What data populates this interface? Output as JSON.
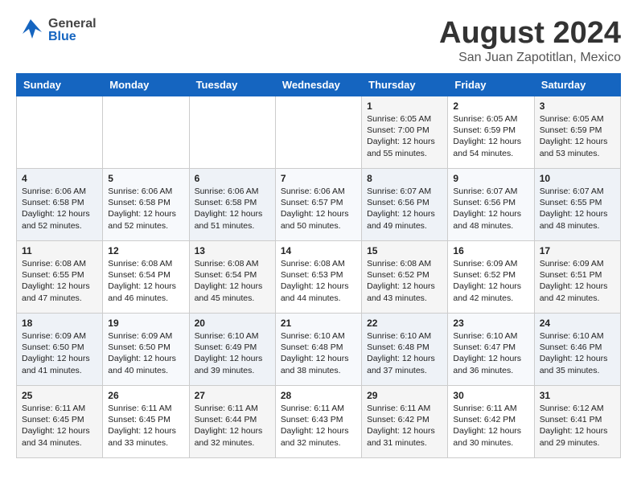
{
  "header": {
    "logo_general": "General",
    "logo_blue": "Blue",
    "month_year": "August 2024",
    "location": "San Juan Zapotitlan, Mexico"
  },
  "days_of_week": [
    "Sunday",
    "Monday",
    "Tuesday",
    "Wednesday",
    "Thursday",
    "Friday",
    "Saturday"
  ],
  "weeks": [
    [
      {
        "day": "",
        "info": ""
      },
      {
        "day": "",
        "info": ""
      },
      {
        "day": "",
        "info": ""
      },
      {
        "day": "",
        "info": ""
      },
      {
        "day": "1",
        "info": "Sunrise: 6:05 AM\nSunset: 7:00 PM\nDaylight: 12 hours\nand 55 minutes."
      },
      {
        "day": "2",
        "info": "Sunrise: 6:05 AM\nSunset: 6:59 PM\nDaylight: 12 hours\nand 54 minutes."
      },
      {
        "day": "3",
        "info": "Sunrise: 6:05 AM\nSunset: 6:59 PM\nDaylight: 12 hours\nand 53 minutes."
      }
    ],
    [
      {
        "day": "4",
        "info": "Sunrise: 6:06 AM\nSunset: 6:58 PM\nDaylight: 12 hours\nand 52 minutes."
      },
      {
        "day": "5",
        "info": "Sunrise: 6:06 AM\nSunset: 6:58 PM\nDaylight: 12 hours\nand 52 minutes."
      },
      {
        "day": "6",
        "info": "Sunrise: 6:06 AM\nSunset: 6:58 PM\nDaylight: 12 hours\nand 51 minutes."
      },
      {
        "day": "7",
        "info": "Sunrise: 6:06 AM\nSunset: 6:57 PM\nDaylight: 12 hours\nand 50 minutes."
      },
      {
        "day": "8",
        "info": "Sunrise: 6:07 AM\nSunset: 6:56 PM\nDaylight: 12 hours\nand 49 minutes."
      },
      {
        "day": "9",
        "info": "Sunrise: 6:07 AM\nSunset: 6:56 PM\nDaylight: 12 hours\nand 48 minutes."
      },
      {
        "day": "10",
        "info": "Sunrise: 6:07 AM\nSunset: 6:55 PM\nDaylight: 12 hours\nand 48 minutes."
      }
    ],
    [
      {
        "day": "11",
        "info": "Sunrise: 6:08 AM\nSunset: 6:55 PM\nDaylight: 12 hours\nand 47 minutes."
      },
      {
        "day": "12",
        "info": "Sunrise: 6:08 AM\nSunset: 6:54 PM\nDaylight: 12 hours\nand 46 minutes."
      },
      {
        "day": "13",
        "info": "Sunrise: 6:08 AM\nSunset: 6:54 PM\nDaylight: 12 hours\nand 45 minutes."
      },
      {
        "day": "14",
        "info": "Sunrise: 6:08 AM\nSunset: 6:53 PM\nDaylight: 12 hours\nand 44 minutes."
      },
      {
        "day": "15",
        "info": "Sunrise: 6:08 AM\nSunset: 6:52 PM\nDaylight: 12 hours\nand 43 minutes."
      },
      {
        "day": "16",
        "info": "Sunrise: 6:09 AM\nSunset: 6:52 PM\nDaylight: 12 hours\nand 42 minutes."
      },
      {
        "day": "17",
        "info": "Sunrise: 6:09 AM\nSunset: 6:51 PM\nDaylight: 12 hours\nand 42 minutes."
      }
    ],
    [
      {
        "day": "18",
        "info": "Sunrise: 6:09 AM\nSunset: 6:50 PM\nDaylight: 12 hours\nand 41 minutes."
      },
      {
        "day": "19",
        "info": "Sunrise: 6:09 AM\nSunset: 6:50 PM\nDaylight: 12 hours\nand 40 minutes."
      },
      {
        "day": "20",
        "info": "Sunrise: 6:10 AM\nSunset: 6:49 PM\nDaylight: 12 hours\nand 39 minutes."
      },
      {
        "day": "21",
        "info": "Sunrise: 6:10 AM\nSunset: 6:48 PM\nDaylight: 12 hours\nand 38 minutes."
      },
      {
        "day": "22",
        "info": "Sunrise: 6:10 AM\nSunset: 6:48 PM\nDaylight: 12 hours\nand 37 minutes."
      },
      {
        "day": "23",
        "info": "Sunrise: 6:10 AM\nSunset: 6:47 PM\nDaylight: 12 hours\nand 36 minutes."
      },
      {
        "day": "24",
        "info": "Sunrise: 6:10 AM\nSunset: 6:46 PM\nDaylight: 12 hours\nand 35 minutes."
      }
    ],
    [
      {
        "day": "25",
        "info": "Sunrise: 6:11 AM\nSunset: 6:45 PM\nDaylight: 12 hours\nand 34 minutes."
      },
      {
        "day": "26",
        "info": "Sunrise: 6:11 AM\nSunset: 6:45 PM\nDaylight: 12 hours\nand 33 minutes."
      },
      {
        "day": "27",
        "info": "Sunrise: 6:11 AM\nSunset: 6:44 PM\nDaylight: 12 hours\nand 32 minutes."
      },
      {
        "day": "28",
        "info": "Sunrise: 6:11 AM\nSunset: 6:43 PM\nDaylight: 12 hours\nand 32 minutes."
      },
      {
        "day": "29",
        "info": "Sunrise: 6:11 AM\nSunset: 6:42 PM\nDaylight: 12 hours\nand 31 minutes."
      },
      {
        "day": "30",
        "info": "Sunrise: 6:11 AM\nSunset: 6:42 PM\nDaylight: 12 hours\nand 30 minutes."
      },
      {
        "day": "31",
        "info": "Sunrise: 6:12 AM\nSunset: 6:41 PM\nDaylight: 12 hours\nand 29 minutes."
      }
    ]
  ]
}
